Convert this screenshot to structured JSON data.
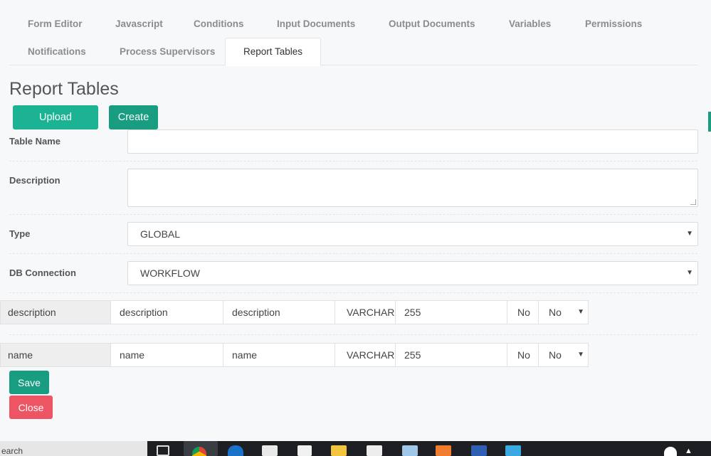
{
  "tabs": [
    "Form Editor",
    "Javascript",
    "Conditions",
    "Input Documents",
    "Output Documents",
    "Variables",
    "Permissions",
    "Notifications",
    "Process Supervisors",
    "Report Tables"
  ],
  "page_title": "Report Tables",
  "buttons": {
    "upload": "Upload",
    "create": "Create",
    "save": "Save",
    "close": "Close"
  },
  "form": {
    "table_name_label": "Table Name",
    "table_name_value": "",
    "description_label": "Description",
    "description_value": "",
    "type_label": "Type",
    "type_value": "GLOBAL",
    "db_connection_label": "DB Connection",
    "db_connection_value": "WORKFLOW"
  },
  "columns": [
    {
      "field": "description",
      "name": "description",
      "label": "description",
      "type": "VARCHAR",
      "size": "255",
      "flag": "No",
      "option": "No"
    },
    {
      "field": "name",
      "name": "name",
      "label": "name",
      "type": "VARCHAR",
      "size": "255",
      "flag": "No",
      "option": "No"
    }
  ],
  "taskbar": {
    "search_text": "earch"
  },
  "colors": {
    "primary": "#1bb394",
    "primary_dark": "#189d81",
    "danger": "#ed5565"
  }
}
